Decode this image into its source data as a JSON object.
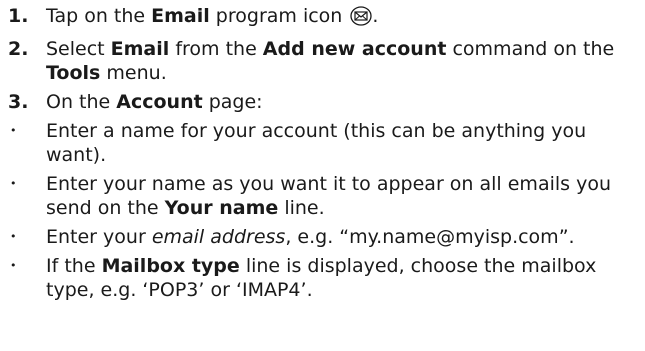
{
  "steps": [
    {
      "number": "1.",
      "parts": [
        "Tap on the ",
        "Email",
        " program icon ",
        "."
      ]
    },
    {
      "number": "2.",
      "parts": [
        "Select ",
        "Email",
        " from the ",
        "Add new account",
        " command on the ",
        "Tools",
        " menu."
      ]
    },
    {
      "number": "3.",
      "parts": [
        "On the ",
        "Account",
        " page:"
      ]
    }
  ],
  "bullets": [
    {
      "symbol": "•",
      "parts": [
        "Enter a name for your account (this can be anything you want)."
      ]
    },
    {
      "symbol": "•",
      "parts": [
        "Enter your name as you want it to appear on all emails you send on the ",
        "Your name",
        " line."
      ]
    },
    {
      "symbol": "•",
      "parts": [
        "Enter your ",
        "email address",
        ", e.g. “my.name@myisp.com”."
      ]
    },
    {
      "symbol": "•",
      "parts": [
        "If the ",
        "Mailbox type",
        " line is displayed, choose the mailbox type, e.g. ‘POP3’ or ‘IMAP4’."
      ]
    }
  ],
  "icons": {
    "email_program_icon": "envelope-icon"
  }
}
